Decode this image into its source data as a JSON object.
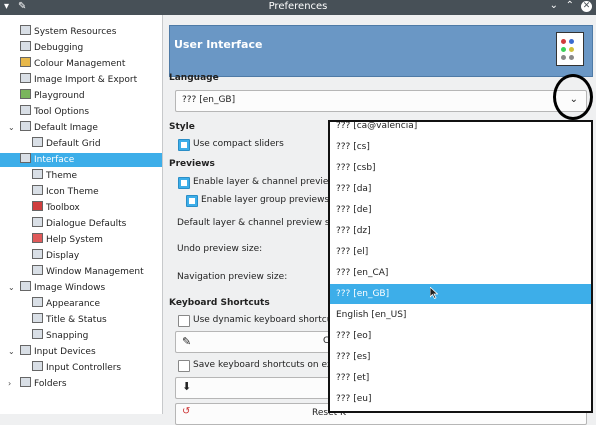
{
  "window": {
    "title": "Preferences"
  },
  "sidebar": {
    "items": [
      {
        "label": "System Resources"
      },
      {
        "label": "Debugging"
      },
      {
        "label": "Colour Management"
      },
      {
        "label": "Image Import & Export"
      },
      {
        "label": "Playground"
      },
      {
        "label": "Tool Options"
      },
      {
        "label": "Default Image"
      },
      {
        "label": "Default Grid"
      },
      {
        "label": "Interface"
      },
      {
        "label": "Theme"
      },
      {
        "label": "Icon Theme"
      },
      {
        "label": "Toolbox"
      },
      {
        "label": "Dialogue Defaults"
      },
      {
        "label": "Help System"
      },
      {
        "label": "Display"
      },
      {
        "label": "Window Management"
      },
      {
        "label": "Image Windows"
      },
      {
        "label": "Appearance"
      },
      {
        "label": "Title & Status"
      },
      {
        "label": "Snapping"
      },
      {
        "label": "Input Devices"
      },
      {
        "label": "Input Controllers"
      },
      {
        "label": "Folders"
      }
    ]
  },
  "main": {
    "header_title": "User Interface",
    "language_section": "Language",
    "language_value": "??? [en_GB]",
    "style_section": "Style",
    "compact_sliders": "Use compact sliders",
    "previews_section": "Previews",
    "layer_channel_previews": "Enable layer & channel previews",
    "layer_group_previews": "Enable layer group previews",
    "default_preview_size": "Default layer & channel preview size:",
    "undo_preview_size": "Undo preview size:",
    "navigation_preview_size": "Navigation preview size:",
    "shortcuts_section": "Keyboard Shortcuts",
    "dynamic_shortcuts": "Use dynamic keyboard shortcuts",
    "configure_button": "C",
    "save_on_exit": "Save keyboard shortcuts on exit",
    "reset_button": "Reset K"
  },
  "dropdown": {
    "options": [
      "??? [ca@valencia]",
      "??? [cs]",
      "??? [csb]",
      "??? [da]",
      "??? [de]",
      "??? [dz]",
      "??? [el]",
      "??? [en_CA]",
      "??? [en_GB]",
      "English [en_US]",
      "??? [eo]",
      "??? [es]",
      "??? [et]",
      "??? [eu]"
    ],
    "highlighted": "??? [en_GB]"
  },
  "colors": {
    "accent": "#3daee9",
    "header": "#6a97c5",
    "titlebar": "#475057"
  }
}
